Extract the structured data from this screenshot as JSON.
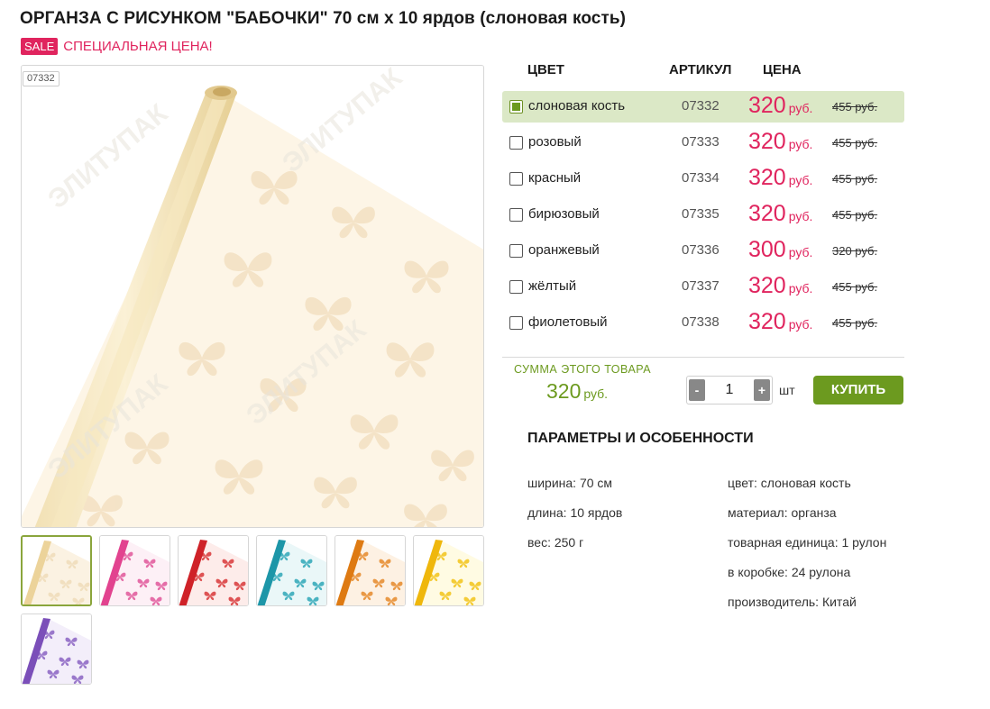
{
  "product": {
    "title": "ОРГАНЗА С РИСУНКОМ \"БАБОЧКИ\" 70 см x 10 ярдов (слоновая кость)",
    "sale_badge": "SALE",
    "sale_text": "СПЕЦИАЛЬНАЯ ЦЕНА!",
    "image_sku": "07332"
  },
  "table": {
    "headers": {
      "color": "ЦВЕТ",
      "sku": "АРТИКУЛ",
      "price": "ЦЕНА"
    },
    "rows": [
      {
        "color": "слоновая кость",
        "sku": "07332",
        "price": "320",
        "currency": "руб.",
        "old_price": "455 руб.",
        "selected": true
      },
      {
        "color": "розовый",
        "sku": "07333",
        "price": "320",
        "currency": "руб.",
        "old_price": "455 руб.",
        "selected": false
      },
      {
        "color": "красный",
        "sku": "07334",
        "price": "320",
        "currency": "руб.",
        "old_price": "455 руб.",
        "selected": false
      },
      {
        "color": "бирюзовый",
        "sku": "07335",
        "price": "320",
        "currency": "руб.",
        "old_price": "455 руб.",
        "selected": false
      },
      {
        "color": "оранжевый",
        "sku": "07336",
        "price": "300",
        "currency": "руб.",
        "old_price": "320 руб.",
        "selected": false
      },
      {
        "color": "жёлтый",
        "sku": "07337",
        "price": "320",
        "currency": "руб.",
        "old_price": "455 руб.",
        "selected": false
      },
      {
        "color": "фиолетовый",
        "sku": "07338",
        "price": "320",
        "currency": "руб.",
        "old_price": "455 руб.",
        "selected": false
      }
    ]
  },
  "summary": {
    "label": "СУММА ЭТОГО ТОВАРА",
    "value": "320",
    "currency": "руб."
  },
  "quantity": {
    "minus": "-",
    "plus": "+",
    "value": "1",
    "unit": "шт"
  },
  "buy_label": "КУПИТЬ",
  "params": {
    "title": "ПАРАМЕТРЫ И ОСОБЕННОСТИ",
    "left": [
      "ширина: 70 см",
      "длина: 10 ярдов",
      "вес: 250 г"
    ],
    "right": [
      "цвет: слоновая кость",
      "материал: органза",
      "товарная единица: 1 рулон",
      "в коробке: 24 рулона",
      "производитель: Китай"
    ]
  },
  "thumbnails": [
    {
      "name": "ivory",
      "bg": "#fbf2e2",
      "motif": "#efdcb8",
      "roll": "#ecd39a"
    },
    {
      "name": "pink",
      "bg": "#fdf0f6",
      "motif": "#e0579a",
      "roll": "#e2438f"
    },
    {
      "name": "red",
      "bg": "#fdecea",
      "motif": "#d8383a",
      "roll": "#cf2228"
    },
    {
      "name": "turquoise",
      "bg": "#eaf7f8",
      "motif": "#2fa7b7",
      "roll": "#1d96a8"
    },
    {
      "name": "orange",
      "bg": "#fdf1e3",
      "motif": "#e58a2a",
      "roll": "#de7a12"
    },
    {
      "name": "yellow",
      "bg": "#fffbe3",
      "motif": "#f2c31a",
      "roll": "#efb70c"
    },
    {
      "name": "violet",
      "bg": "#f3eefa",
      "motif": "#8a63c2",
      "roll": "#7b4fb9"
    }
  ],
  "colors": {
    "accent_green": "#6c9a1f",
    "sale_red": "#e0245e",
    "selected_row": "#dbe8c6"
  }
}
